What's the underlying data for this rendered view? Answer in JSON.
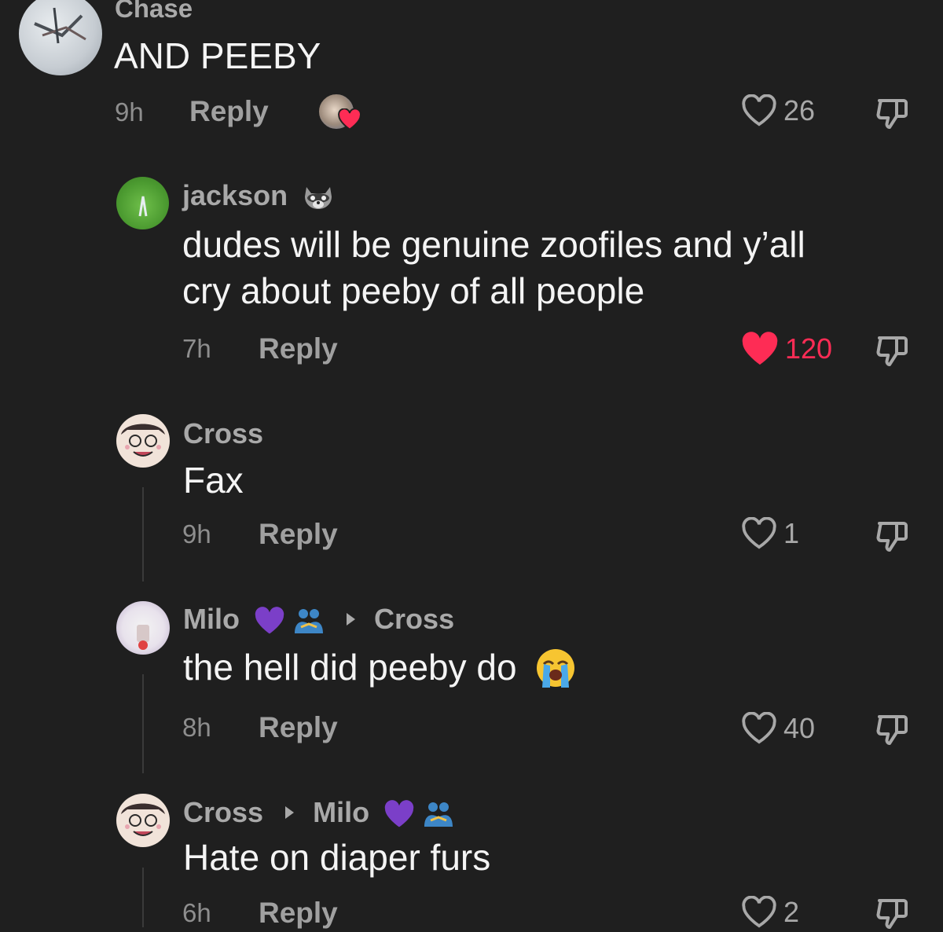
{
  "comments": [
    {
      "user": "Chase",
      "text": "AND PEEBY",
      "time": "9h",
      "reply_label": "Reply",
      "likes": "26",
      "liked": false,
      "creator_liked": true
    },
    {
      "user": "jackson",
      "user_badge": "raccoon-emoji",
      "text_line1": "dudes will be genuine zoofiles and y’all",
      "text_line2": "cry about peeby of all people",
      "time": "7h",
      "reply_label": "Reply",
      "likes": "120",
      "liked": true
    },
    {
      "user": "Cross",
      "text": "Fax",
      "time": "9h",
      "reply_label": "Reply",
      "likes": "1",
      "liked": false
    },
    {
      "user": "Milo",
      "user_badges": [
        "purple-heart-emoji",
        "people-hugging-emoji"
      ],
      "reply_to": "Cross",
      "text": "the hell did peeby do",
      "text_emoji": "loudly-crying-face-emoji",
      "time": "8h",
      "reply_label": "Reply",
      "likes": "40",
      "liked": false
    },
    {
      "user": "Cross",
      "reply_to": "Milo",
      "reply_to_badges": [
        "purple-heart-emoji",
        "people-hugging-emoji"
      ],
      "text": "Hate on diaper furs",
      "time": "6h",
      "reply_label": "Reply",
      "likes": "2",
      "liked": false
    }
  ],
  "colors": {
    "background": "#1f1f1f",
    "liked_red": "#fe2c55",
    "muted": "#a0a0a0"
  }
}
